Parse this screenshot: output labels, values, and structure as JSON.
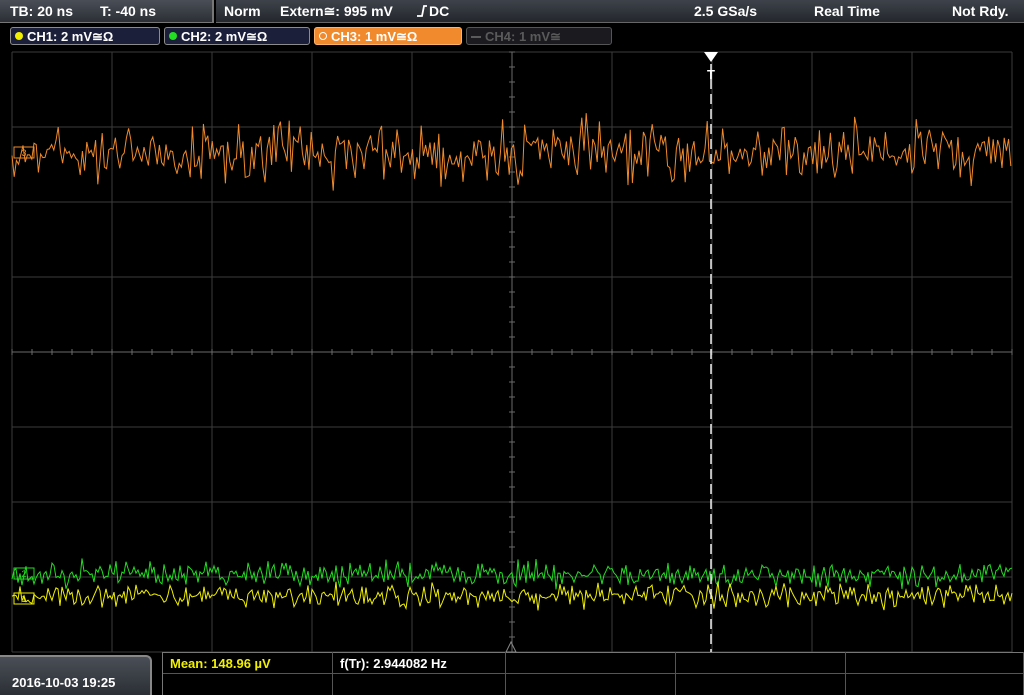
{
  "topbar": {
    "timebase": "TB: 20 ns",
    "trigger_time": "T: -40 ns",
    "acq_mode": "Norm",
    "trigger_source": "Extern≅: 995 mV",
    "trigger_coupling": "DC",
    "sample_rate": "2.5 GSa/s",
    "time_mode": "Real Time",
    "status": "Not Rdy."
  },
  "channels": [
    {
      "label": "CH1: 2 mV≅Ω",
      "color": "#f0f000",
      "active": true
    },
    {
      "label": "CH2: 2 mV≅Ω",
      "color": "#22dd22",
      "active": true
    },
    {
      "label": "CH3: 1 mV≅Ω",
      "color": "#f08a2c",
      "active": true
    },
    {
      "label": "CH4: 1 mV≅",
      "color": "#5a5a5a",
      "active": false
    }
  ],
  "markers": {
    "ch1": "1",
    "ch2": "2",
    "ch3": "3",
    "trigger": "T"
  },
  "bottom": {
    "datetime": "2016-10-03 19:25",
    "mean": "Mean: 148.96 µV",
    "freq": "f(Tr): 2.944082 Hz"
  },
  "colors": {
    "grid": "#3c3c3c",
    "grid_center": "#6a6a6a",
    "ch1": "#f0f000",
    "ch2": "#22dd22",
    "ch3": "#f08a2c",
    "trigger": "#ffffff"
  }
}
